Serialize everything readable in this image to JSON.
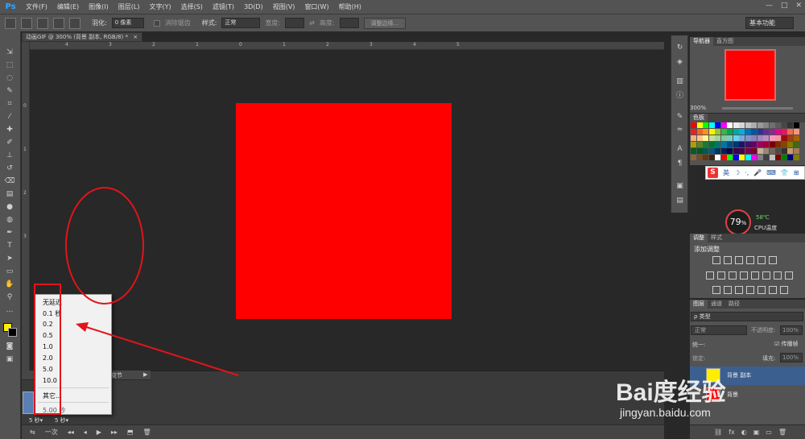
{
  "app": {
    "logo": "Ps"
  },
  "menu": [
    "文件(F)",
    "编辑(E)",
    "图像(I)",
    "图层(L)",
    "文字(Y)",
    "选择(S)",
    "滤镜(T)",
    "3D(D)",
    "视图(V)",
    "窗口(W)",
    "帮助(H)"
  ],
  "window_controls": [
    "—",
    "□",
    "✕"
  ],
  "options": {
    "feather_label": "羽化:",
    "feather_value": "0 像素",
    "antialias_label": "消除锯齿",
    "style_label": "样式:",
    "style_value": "正常",
    "width_label": "宽度:",
    "height_label": "高度:",
    "refine_edge_label": "调整边缘...",
    "workspace": "基本功能"
  },
  "document": {
    "tab_title": "动画GIF @ 300% (背景 副本, RGB/8) *",
    "tab_close": "×",
    "color": "#fe0000",
    "ruler_h": [
      "4",
      "3",
      "2",
      "1",
      "0",
      "1",
      "2",
      "3",
      "4",
      "5"
    ],
    "ruler_v": [
      "0",
      "1",
      "2",
      "3"
    ]
  },
  "colors": {
    "foreground": "#ffee00",
    "background": "#000000"
  },
  "timeline": {
    "header_label": "变节",
    "frame_time": "5 秒▾",
    "frame_time2": "5 秒▾",
    "loop_label": "一次",
    "controls": [
      "◂◂",
      "◂",
      "▶",
      "▸▸",
      "⬒",
      "🗑"
    ]
  },
  "frame_delay_menu": {
    "items": [
      "无延迟",
      "0.1 秒",
      "0.2",
      "0.5",
      "1.0",
      "2.0",
      "5.0",
      "10.0"
    ],
    "other": "其它...",
    "current": "5.00 秒"
  },
  "panels": {
    "navigator_tabs": [
      "导航器",
      "直方图"
    ],
    "zoom": "300%",
    "swatches_tab": "色板",
    "adjustments_tabs": [
      "调整",
      "样式"
    ],
    "add_adjustment": "添加调整",
    "layers_tabs": [
      "图层",
      "通道",
      "路径"
    ],
    "layer_filter": "ρ 类型",
    "blend_mode": "正常",
    "opacity_label": "不透明度:",
    "opacity_value": "100%",
    "unify_label": "统一:",
    "propagate_label": "传播帧",
    "lock_label": "锁定:",
    "fill_label": "填充:",
    "fill_value": "100%",
    "layers": [
      {
        "name": "背景 副本",
        "color": "#ffee00"
      },
      {
        "name": "背景",
        "color": "#fe0000"
      }
    ],
    "layer_bottom_icons": [
      "⛓",
      "fx",
      "◐",
      "▣",
      "▭",
      "🗑"
    ]
  },
  "sogou": {
    "logo": "S",
    "mode": "英",
    "icons": [
      "☽",
      "·,",
      "🎤",
      "⌨",
      "👕",
      "⊞"
    ]
  },
  "cpu": {
    "percent": "79",
    "unit": "%",
    "temp": "58℃",
    "label": "CPU温度"
  },
  "watermark": {
    "text": "Bai度经验",
    "url": "jingyan.baidu.com"
  },
  "swatch_colors": [
    [
      "#ff0000",
      "#ffff00",
      "#00ff00",
      "#00ffff",
      "#0000ff",
      "#ff00ff",
      "#ffffff",
      "#ebebeb",
      "#d6d6d6",
      "#c2c2c2",
      "#adadad",
      "#999999",
      "#858585",
      "#707070",
      "#5c5c5c",
      "#474747",
      "#333333",
      "#000000"
    ],
    [
      "#ee1d24",
      "#f16522",
      "#f7941d",
      "#fff200",
      "#8dc63f",
      "#39b54a",
      "#00a651",
      "#00a99d",
      "#00aeef",
      "#0072bc",
      "#0054a6",
      "#2e3192",
      "#662d91",
      "#92278f",
      "#ec008c",
      "#ed145b",
      "#f26c4f",
      "#f69679"
    ],
    [
      "#f9ad81",
      "#fdc689",
      "#fff799",
      "#c4df9b",
      "#a3d39c",
      "#82ca9c",
      "#7accc8",
      "#6dcff6",
      "#7da7d9",
      "#8393ca",
      "#8781bd",
      "#a186be",
      "#bd8cbf",
      "#f49ac1",
      "#f5989d",
      "#9e0b0f",
      "#a0410d",
      "#a3620a"
    ],
    [
      "#aba000",
      "#598527",
      "#1a7b30",
      "#007236",
      "#00746b",
      "#0076a3",
      "#004b80",
      "#003471",
      "#1b1464",
      "#440e62",
      "#630460",
      "#9e005d",
      "#9e0039",
      "#790000",
      "#7b2e00",
      "#7d4900",
      "#827b00",
      "#406618"
    ],
    [
      "#005e20",
      "#005826",
      "#005952",
      "#005b7f",
      "#003663",
      "#002157",
      "#0d004c",
      "#32004b",
      "#4b0049",
      "#7b0046",
      "#7a0026",
      "#c7b299",
      "#998675",
      "#736357",
      "#534741",
      "#37302a",
      "#c69c6d",
      "#a67c52"
    ],
    [
      "#8c6239",
      "#754c24",
      "#603913",
      "#3c2415",
      "#ffffff",
      "#ff0000",
      "#00ff00",
      "#0000ff",
      "#ffff00",
      "#00ffff",
      "#ff00ff",
      "#808080",
      "#404040",
      "#c0c0c0",
      "#800000",
      "#008000",
      "#000080",
      "#808000"
    ]
  ]
}
